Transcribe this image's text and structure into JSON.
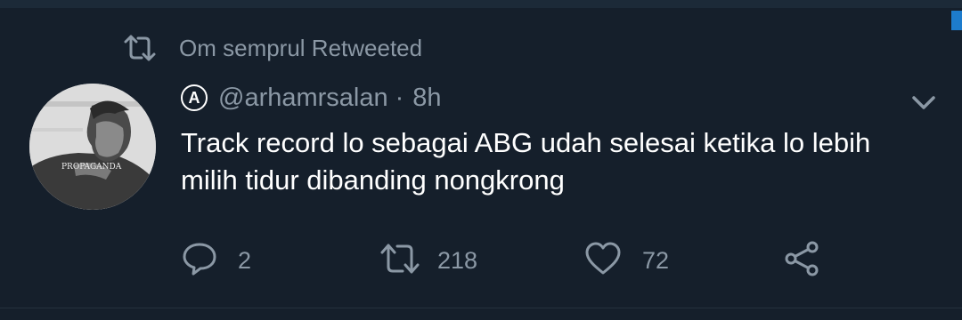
{
  "retweet_notice": {
    "text": "Om semprul Retweeted"
  },
  "tweet": {
    "verified_symbol": "A",
    "handle": "@arhamrsalan",
    "separator": "·",
    "time": "8h",
    "text_lines": [
      "Track record lo sebagai ABG udah selesai ketika lo lebih",
      "milih tidur dibanding nongkrong"
    ],
    "avatar_shirt_text": "PROPAGANDA"
  },
  "actions": {
    "reply_count": "2",
    "retweet_count": "218",
    "like_count": "72"
  },
  "colors": {
    "background": "#151f2b",
    "secondary_text": "#8b98a5",
    "primary_text": "#ffffff",
    "accent": "#1d7ccd"
  },
  "icons": [
    "retweet-icon",
    "chevron-down-icon",
    "reply-icon",
    "like-icon",
    "share-icon"
  ]
}
